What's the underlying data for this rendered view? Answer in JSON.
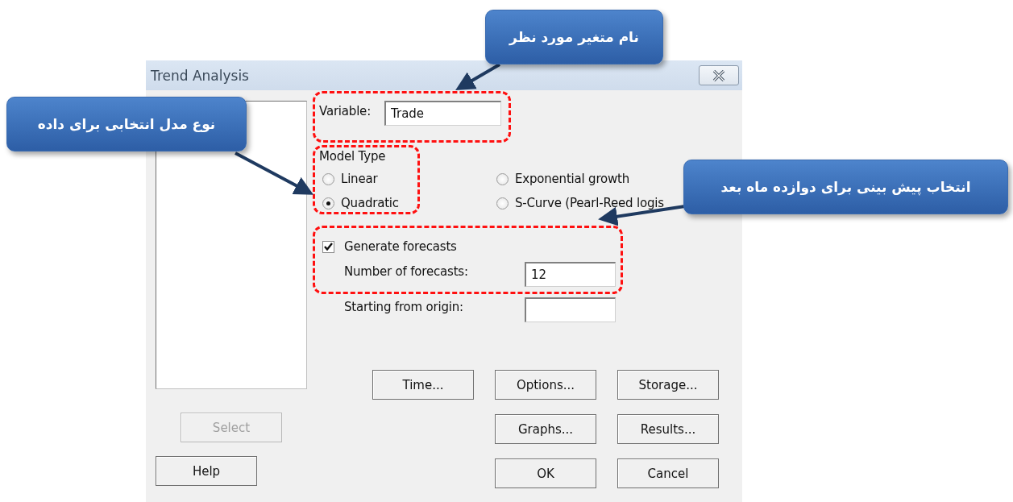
{
  "window": {
    "title": "Trend Analysis"
  },
  "variable": {
    "label": "Variable:",
    "value": "Trade"
  },
  "model_type": {
    "label": "Model Type",
    "options": [
      {
        "label": "Linear",
        "selected": false
      },
      {
        "label": "Quadratic",
        "selected": true
      },
      {
        "label": "Exponential growth",
        "selected": false
      },
      {
        "label": "S-Curve (Pearl-Reed logis",
        "selected": false
      }
    ]
  },
  "generate_forecasts": {
    "label": "Generate forecasts",
    "checked": true
  },
  "fields": [
    {
      "label": "Number of forecasts:",
      "value": "12"
    },
    {
      "label": "Starting from origin:"
    }
  ],
  "button_rows": [
    {
      "right": [
        {
          "label": "Time...",
          "disabled": false
        },
        {
          "label": "Options...",
          "disabled": false
        },
        {
          "label": "Storage...",
          "disabled": false
        }
      ]
    },
    {
      "left": {
        "label": "Select",
        "disabled": true
      },
      "right": [
        {
          "label": "Graphs...",
          "disabled": false
        },
        {
          "label": "Results...",
          "disabled": false
        }
      ]
    },
    {
      "left": {
        "label": "Help",
        "disabled": false
      },
      "right": [
        {
          "label": "OK",
          "disabled": false
        },
        {
          "label": "Cancel",
          "disabled": false
        }
      ]
    }
  ],
  "annotations": [
    {
      "text": "نام متغیر مورد نظر"
    },
    {
      "text": "نوع مدل انتخابی برای داده"
    },
    {
      "text": "انتخاب پیش بینی برای دوازده ماه بعد"
    }
  ]
}
